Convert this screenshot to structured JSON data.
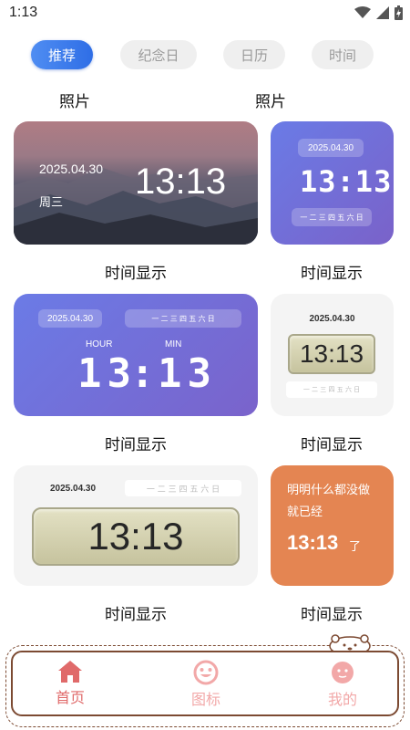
{
  "status": {
    "time": "1:13"
  },
  "tabs": [
    {
      "label": "推荐",
      "active": true
    },
    {
      "label": "纪念日",
      "active": false
    },
    {
      "label": "日历",
      "active": false
    },
    {
      "label": "时间",
      "active": false
    }
  ],
  "sections": {
    "left": "照片",
    "right": "照片"
  },
  "cards": {
    "photo": {
      "date": "2025.04.30",
      "weekday": "周三",
      "time": "13:13",
      "label": "时间显示"
    },
    "purple_small": {
      "date": "2025.04.30",
      "time": "13:13",
      "week": "一 二 三 四 五 六 日",
      "label": "时间显示"
    },
    "purple_large": {
      "date": "2025.04.30",
      "week": "一 二 三 四 五 六 日",
      "hour_label": "HOUR",
      "min_label": "MIN",
      "hour": "13",
      "sep": ":",
      "minute": "13",
      "label": "时间显示"
    },
    "lcd_small": {
      "date": "2025.04.30",
      "time": "13:13",
      "week": "一 二 三 四 五 六 日",
      "label": "时间显示"
    },
    "lcd_large": {
      "date": "2025.04.30",
      "week": "一 二 三 四 五 六 日",
      "time": "13:13",
      "label": "时间显示"
    },
    "orange": {
      "line1": "明明什么都没做",
      "line2": "就已经",
      "time": "13:13",
      "suffix": "了",
      "label": "时间显示"
    }
  },
  "nav": {
    "home": "首页",
    "icons": "图标",
    "mine": "我的"
  },
  "colors": {
    "accent": "#2f6ee6",
    "nav_active": "#e06a6a",
    "nav_inactive": "#f2a8a8",
    "orange": "#e48552"
  }
}
